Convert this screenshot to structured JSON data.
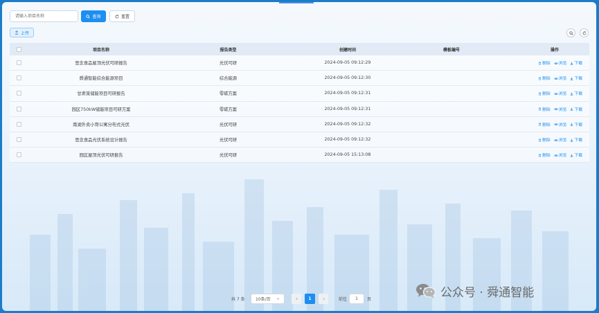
{
  "toolbar": {
    "search_placeholder": "请输入项目名称",
    "query_label": "查询",
    "reset_label": "重置",
    "upload_label": "上传"
  },
  "table": {
    "headers": {
      "name": "项目名称",
      "type": "报告类型",
      "time": "创建时间",
      "template": "模板编号",
      "ops": "操作"
    },
    "ops_labels": {
      "delete": "删除",
      "preview": "浏览",
      "download": "下载"
    },
    "rows": [
      {
        "name": "思念食品屋顶光伏可研报告",
        "type": "光伏可研",
        "time": "2024-09-05 09:12:29",
        "template": ""
      },
      {
        "name": "舜通智能综合能源项目",
        "type": "综合能源",
        "time": "2024-09-05 09:12:30",
        "template": ""
      },
      {
        "name": "甘肃某储能项目可研报告",
        "type": "零碳方案",
        "time": "2024-09-05 09:12:31",
        "template": ""
      },
      {
        "name": "园区750kW储能项目可研方案",
        "type": "零碳方案",
        "time": "2024-09-05 09:12:31",
        "template": ""
      },
      {
        "name": "南湖外卖小哥公寓分布式光伏",
        "type": "光伏可研",
        "time": "2024-09-05 09:12:32",
        "template": ""
      },
      {
        "name": "思念食品光伏系统设计报告",
        "type": "光伏可研",
        "time": "2024-09-05 09:12:32",
        "template": ""
      },
      {
        "name": "园区屋顶光伏可研报告",
        "type": "光伏可研",
        "time": "2024-09-05 15:13:08",
        "template": ""
      }
    ]
  },
  "pagination": {
    "total": "共 7 条",
    "page_size": "10条/页",
    "current_page": "1",
    "goto_label": "前往",
    "goto_value": "1",
    "page_suffix": "页"
  },
  "watermark": {
    "text": "公众号 · 舜通智能"
  },
  "colors": {
    "primary": "#1e8ef0",
    "frame_bg": "#1b7cc9"
  }
}
